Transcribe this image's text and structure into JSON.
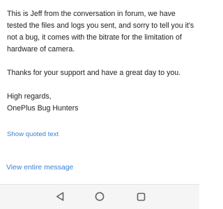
{
  "email": {
    "paragraph_1": "This is Jeff from the conversation in forum, we have tested the files and logs you sent, and sorry to tell you it's not a bug, it comes with the bitrate for the limitation of hardware of camera.",
    "paragraph_2": "Thanks for your support and have a great day to you.",
    "closing": "High regards,",
    "signature": "OnePlus Bug Hunters"
  },
  "links": {
    "show_quoted_text": "Show quoted text",
    "view_entire_message": "View entire message"
  },
  "navigation": {
    "back_icon": "back-triangle-icon",
    "home_icon": "home-circle-icon",
    "recents_icon": "recents-square-icon"
  },
  "colors": {
    "link": "#3b7fd4",
    "text": "#202124",
    "nav_background": "#f5f5f5",
    "nav_icon": "#5f6368"
  }
}
